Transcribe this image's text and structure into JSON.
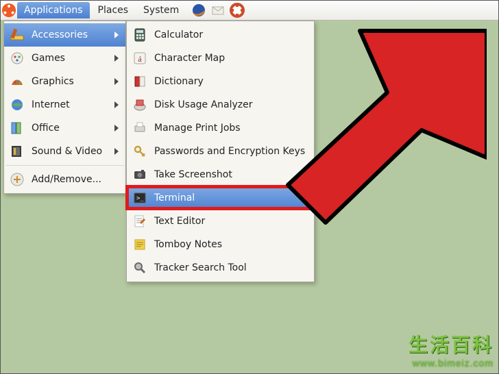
{
  "panel": {
    "items": [
      {
        "label": "Applications",
        "selected": true
      },
      {
        "label": "Places",
        "selected": false
      },
      {
        "label": "System",
        "selected": false
      }
    ],
    "launcher_icons": [
      "firefox-icon",
      "evolution-mail-icon",
      "help-icon"
    ]
  },
  "menu_main": {
    "items": [
      {
        "label": "Accessories",
        "icon": "accessories-icon",
        "selected": true,
        "has_submenu": true
      },
      {
        "label": "Games",
        "icon": "games-icon",
        "selected": false,
        "has_submenu": true
      },
      {
        "label": "Graphics",
        "icon": "graphics-icon",
        "selected": false,
        "has_submenu": true
      },
      {
        "label": "Internet",
        "icon": "internet-icon",
        "selected": false,
        "has_submenu": true
      },
      {
        "label": "Office",
        "icon": "office-icon",
        "selected": false,
        "has_submenu": true
      },
      {
        "label": "Sound & Video",
        "icon": "sound-video-icon",
        "selected": false,
        "has_submenu": true
      }
    ],
    "footer": {
      "label": "Add/Remove...",
      "icon": "add-remove-icon"
    }
  },
  "menu_sub": {
    "items": [
      {
        "label": "Calculator",
        "icon": "calculator-icon",
        "selected": false
      },
      {
        "label": "Character Map",
        "icon": "character-map-icon",
        "selected": false
      },
      {
        "label": "Dictionary",
        "icon": "dictionary-icon",
        "selected": false
      },
      {
        "label": "Disk Usage Analyzer",
        "icon": "disk-usage-icon",
        "selected": false
      },
      {
        "label": "Manage Print Jobs",
        "icon": "printer-icon",
        "selected": false
      },
      {
        "label": "Passwords and Encryption Keys",
        "icon": "keys-icon",
        "selected": false
      },
      {
        "label": "Take Screenshot",
        "icon": "screenshot-icon",
        "selected": false
      },
      {
        "label": "Terminal",
        "icon": "terminal-icon",
        "selected": true
      },
      {
        "label": "Text Editor",
        "icon": "text-editor-icon",
        "selected": false
      },
      {
        "label": "Tomboy Notes",
        "icon": "tomboy-notes-icon",
        "selected": false
      },
      {
        "label": "Tracker Search Tool",
        "icon": "tracker-search-icon",
        "selected": false
      }
    ]
  },
  "watermark": {
    "title": "生活百科",
    "url": "www.bimeiz.com"
  },
  "colors": {
    "selection": "#5588d3",
    "highlight_border": "#e11b1b",
    "desktop": "#b4c9a1"
  }
}
